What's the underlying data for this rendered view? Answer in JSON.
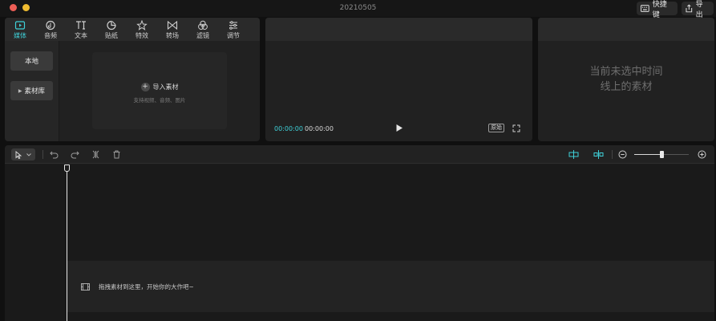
{
  "window": {
    "title": "20210505",
    "shortcut_label": "快捷键",
    "export_label": "导出"
  },
  "media_panel": {
    "tabs": [
      {
        "label": "媒体",
        "icon": "media-icon",
        "active": true
      },
      {
        "label": "音频",
        "icon": "audio-icon",
        "active": false
      },
      {
        "label": "文本",
        "icon": "text-icon",
        "active": false
      },
      {
        "label": "贴纸",
        "icon": "sticker-icon",
        "active": false
      },
      {
        "label": "特效",
        "icon": "effects-icon",
        "active": false
      },
      {
        "label": "转场",
        "icon": "transition-icon",
        "active": false
      },
      {
        "label": "滤镜",
        "icon": "filter-icon",
        "active": false
      },
      {
        "label": "调节",
        "icon": "adjust-icon",
        "active": false
      }
    ],
    "side": {
      "local_label": "本地",
      "library_label": "素材库"
    },
    "import": {
      "title": "导入素材",
      "subtitle": "支持视频、音频、图片"
    }
  },
  "player": {
    "current_time": "00:00:00",
    "total_time": "00:00:00",
    "original_ratio_label": "原始"
  },
  "attributes": {
    "empty_line1": "当前未选中时间",
    "empty_line2": "线上的素材"
  },
  "timeline": {
    "drop_hint": "拖拽素材到这里，开始你的大作吧~",
    "zoom_level": 0.5
  },
  "colors": {
    "accent": "#3fd0d8",
    "background": "#101010",
    "panel": "#212121"
  }
}
